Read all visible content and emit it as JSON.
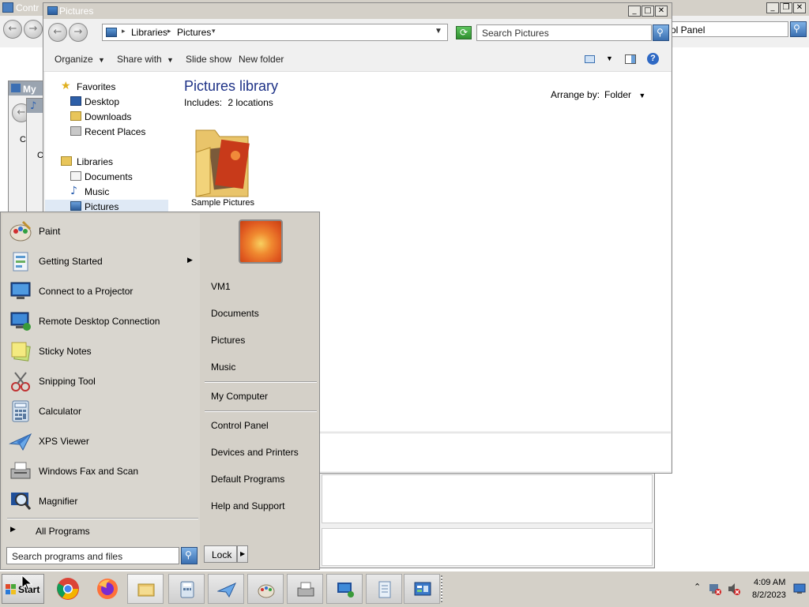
{
  "control_panel": {
    "title": "Contr",
    "search_value": "ol Panel",
    "minimize": "_",
    "restore": "❐",
    "close": "✕"
  },
  "my_window": {
    "title": "My",
    "label_c1": "C",
    "label_c2": "C"
  },
  "explorer": {
    "title": "Pictures",
    "minimize": "_",
    "maximize": "□",
    "close": "✕",
    "breadcrumb": [
      "Libraries",
      "Pictures"
    ],
    "search_placeholder": "Search Pictures",
    "toolbar": {
      "organize": "Organize",
      "share_with": "Share with",
      "slide_show": "Slide show",
      "new_folder": "New folder",
      "help": "?"
    },
    "sidebar": {
      "favorites_header": "Favorites",
      "favorites": [
        "Desktop",
        "Downloads",
        "Recent Places"
      ],
      "libraries_header": "Libraries",
      "libraries": [
        "Documents",
        "Music",
        "Pictures"
      ]
    },
    "library": {
      "heading": "Pictures library",
      "includes_label": "Includes:",
      "includes_link": "2 locations",
      "arrange_label": "Arrange by:",
      "arrange_value": "Folder"
    },
    "items": [
      {
        "name": "Sample Pictures",
        "icon": "folder-pictures-icon"
      }
    ]
  },
  "start_menu": {
    "programs": [
      {
        "label": "Paint",
        "icon": "paint-icon"
      },
      {
        "label": "Getting Started",
        "icon": "getting-started-icon",
        "submenu": true
      },
      {
        "label": "Connect to a Projector",
        "icon": "projector-icon"
      },
      {
        "label": "Remote Desktop Connection",
        "icon": "remote-desktop-icon"
      },
      {
        "label": "Sticky Notes",
        "icon": "sticky-notes-icon"
      },
      {
        "label": "Snipping Tool",
        "icon": "snipping-tool-icon"
      },
      {
        "label": "Calculator",
        "icon": "calculator-icon"
      },
      {
        "label": "XPS Viewer",
        "icon": "xps-viewer-icon"
      },
      {
        "label": "Windows Fax and Scan",
        "icon": "fax-scan-icon"
      },
      {
        "label": "Magnifier",
        "icon": "magnifier-icon"
      }
    ],
    "all_programs": "All Programs",
    "search_placeholder": "Search programs and files",
    "lock": "Lock",
    "right_links": {
      "user": "VM1",
      "documents": "Documents",
      "pictures": "Pictures",
      "music": "Music",
      "my_computer": "My Computer",
      "control_panel": "Control Panel",
      "devices_printers": "Devices and Printers",
      "default_programs": "Default Programs",
      "help_support": "Help and Support"
    }
  },
  "taskbar": {
    "start_label": "Start",
    "pinned": [
      "chrome-icon",
      "firefox-icon",
      "explorer-icon",
      "calculator-icon",
      "xps-viewer-icon",
      "paint-icon",
      "fax-scan-icon",
      "remote-desktop-icon",
      "notepad-icon",
      "control-panel-icon"
    ],
    "clock_time": "4:09 AM",
    "clock_date": "8/2/2023"
  }
}
